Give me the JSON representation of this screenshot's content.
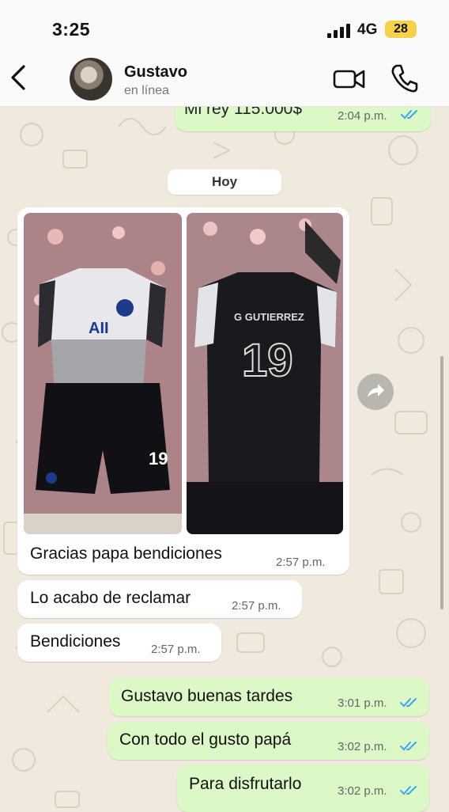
{
  "status_bar": {
    "time": "3:25",
    "network": "4G",
    "battery": "28"
  },
  "header": {
    "contact_name": "Gustavo",
    "contact_status": "en línea"
  },
  "date_separator": "Hoy",
  "messages": [
    {
      "text": "Mi rey 115.000$",
      "time": "2:04 p.m.",
      "direction": "out"
    },
    {
      "text": "Gracias papa bendiciones",
      "time": "2:57 p.m.",
      "direction": "in"
    },
    {
      "text": "Lo acabo de reclamar",
      "time": "2:57 p.m.",
      "direction": "in"
    },
    {
      "text": "Bendiciones",
      "time": "2:57 p.m.",
      "direction": "in"
    },
    {
      "text": "Gustavo buenas tardes",
      "time": "3:01 p.m.",
      "direction": "out"
    },
    {
      "text": "Con todo el gusto papá",
      "time": "3:02 p.m.",
      "direction": "out"
    },
    {
      "text": "Para disfrutarlo",
      "time": "3:02 p.m.",
      "direction": "out"
    }
  ],
  "photos": {
    "left": {
      "jersey_text": "AII",
      "shorts_number": "19"
    },
    "right": {
      "jersey_name": "G GUTIERREZ",
      "jersey_number": "19"
    }
  },
  "colors": {
    "outgoing": "#dcf8c6",
    "incoming": "#ffffff",
    "read_ticks": "#3aa6f0",
    "wallpaper": "#efe9de"
  }
}
